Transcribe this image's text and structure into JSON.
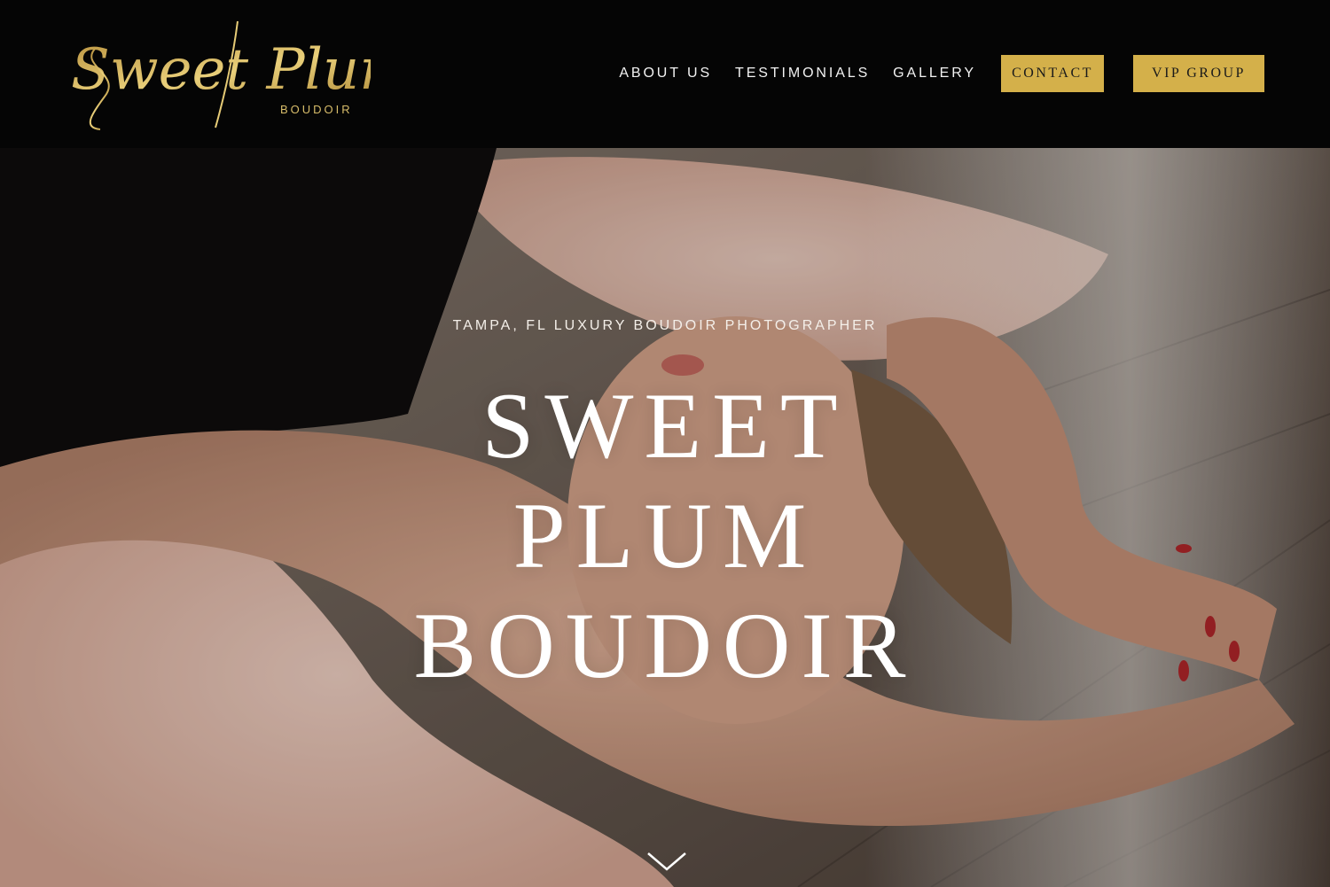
{
  "logo": {
    "script_text": "Sweet Plum",
    "sub_text": "BOUDOIR",
    "color": "#c9a24c"
  },
  "nav": {
    "links": [
      "ABOUT US",
      "TESTIMONIALS",
      "GALLERY"
    ],
    "contact_label": "CONTACT",
    "vip_label": "VIP GROUP",
    "button_color": "#d4b04a"
  },
  "hero": {
    "tagline": "TAMPA, FL LUXURY BOUDOIR PHOTOGRAPHER",
    "title_lines": [
      "SWEET",
      "PLUM",
      "BOUDOIR"
    ],
    "scroll_icon": "chevron-down-icon"
  }
}
